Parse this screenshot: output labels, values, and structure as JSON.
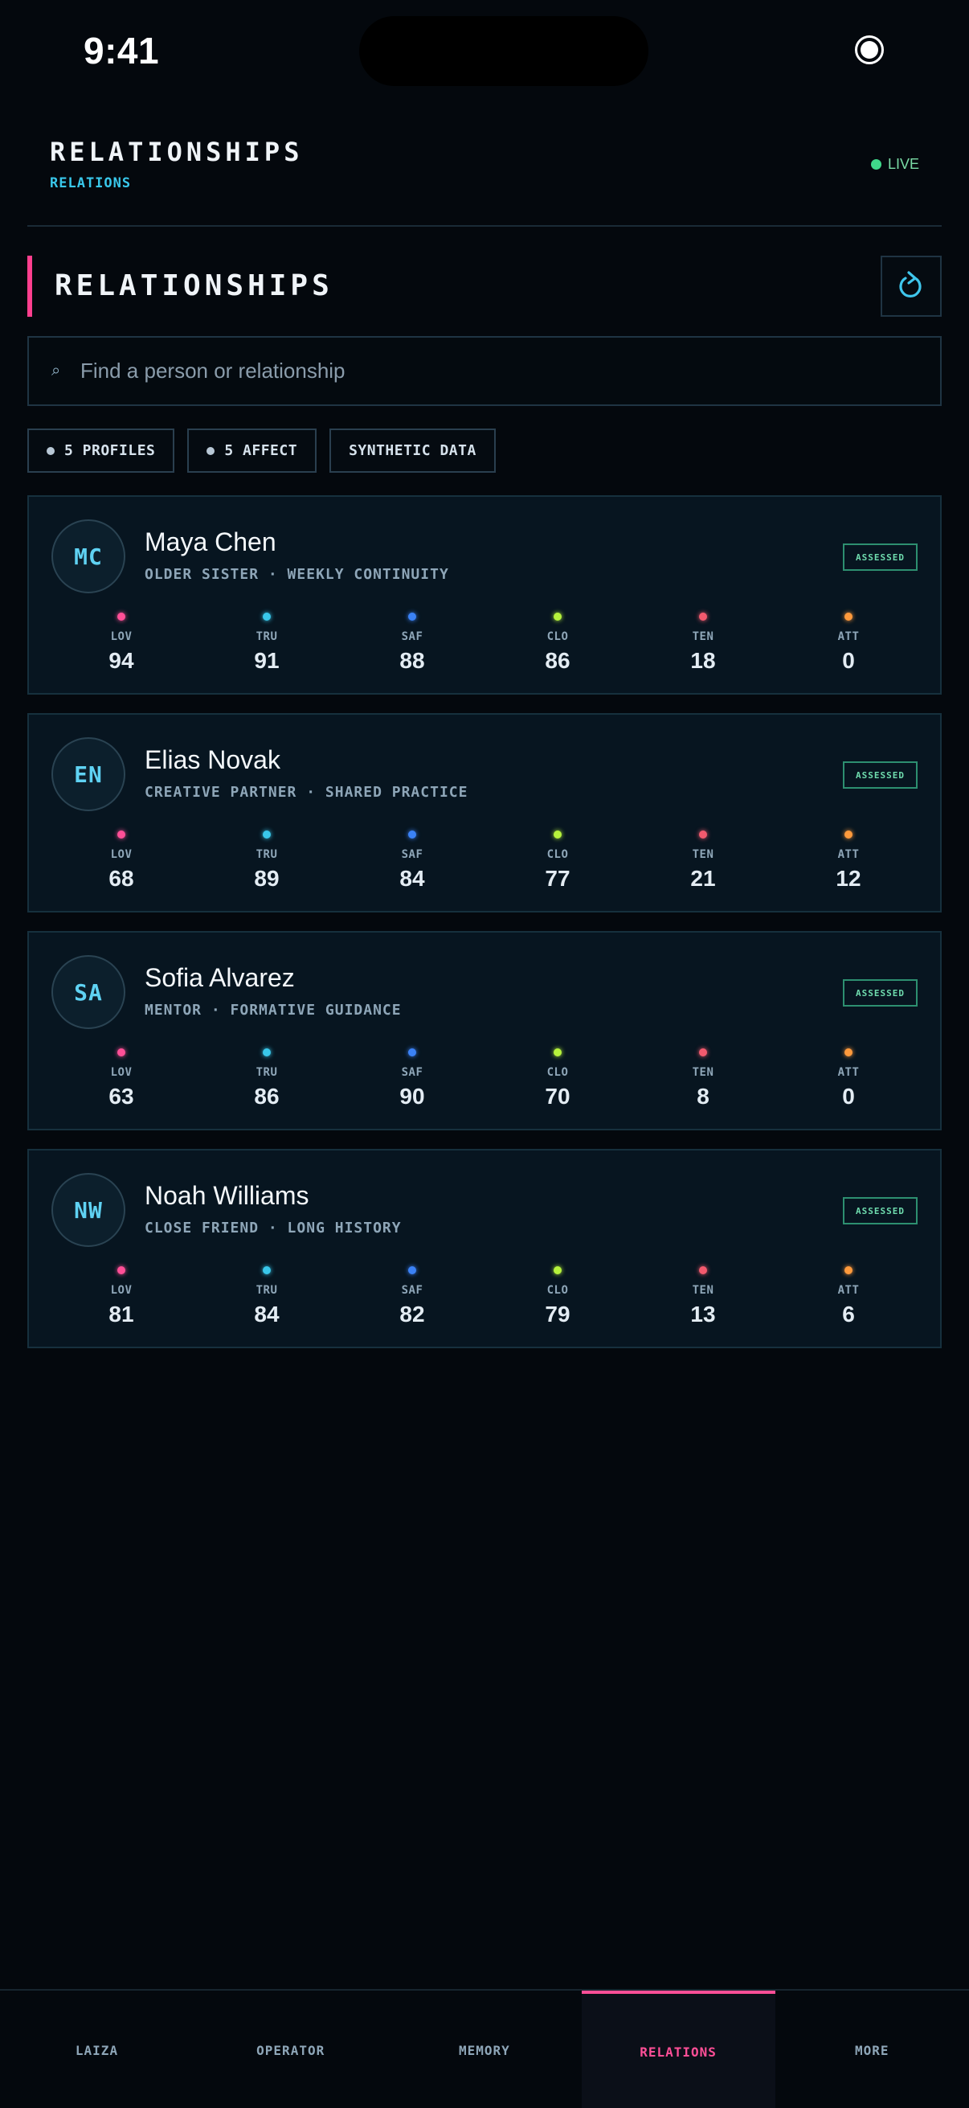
{
  "status_bar": {
    "time": "9:41"
  },
  "header": {
    "title": "RELATIONSHIPS",
    "subtitle": "RELATIONS",
    "live_label": "LIVE"
  },
  "section": {
    "title": "RELATIONSHIPS"
  },
  "search": {
    "placeholder": "Find a person or relationship",
    "value": ""
  },
  "chips": [
    {
      "label": "5 PROFILES",
      "has_dot": true
    },
    {
      "label": "5 AFFECT",
      "has_dot": true
    },
    {
      "label": "SYNTHETIC DATA",
      "has_dot": false
    }
  ],
  "metric_colors": {
    "LOV": "#ff4f97",
    "TRU": "#39c7ea",
    "SAF": "#3b82f6",
    "CLO": "#b6f23c",
    "TEN": "#f25a6e",
    "ATT": "#ff9a3c"
  },
  "people": [
    {
      "initials": "MC",
      "name": "Maya Chen",
      "role": "OLDER SISTER · WEEKLY CONTINUITY",
      "status": "ASSESSED",
      "metrics": [
        {
          "label": "LOV",
          "value": "94"
        },
        {
          "label": "TRU",
          "value": "91"
        },
        {
          "label": "SAF",
          "value": "88"
        },
        {
          "label": "CLO",
          "value": "86"
        },
        {
          "label": "TEN",
          "value": "18"
        },
        {
          "label": "ATT",
          "value": "0"
        }
      ]
    },
    {
      "initials": "EN",
      "name": "Elias Novak",
      "role": "CREATIVE PARTNER · SHARED PRACTICE",
      "status": "ASSESSED",
      "metrics": [
        {
          "label": "LOV",
          "value": "68"
        },
        {
          "label": "TRU",
          "value": "89"
        },
        {
          "label": "SAF",
          "value": "84"
        },
        {
          "label": "CLO",
          "value": "77"
        },
        {
          "label": "TEN",
          "value": "21"
        },
        {
          "label": "ATT",
          "value": "12"
        }
      ]
    },
    {
      "initials": "SA",
      "name": "Sofia Alvarez",
      "role": "MENTOR · FORMATIVE GUIDANCE",
      "status": "ASSESSED",
      "metrics": [
        {
          "label": "LOV",
          "value": "63"
        },
        {
          "label": "TRU",
          "value": "86"
        },
        {
          "label": "SAF",
          "value": "90"
        },
        {
          "label": "CLO",
          "value": "70"
        },
        {
          "label": "TEN",
          "value": "8"
        },
        {
          "label": "ATT",
          "value": "0"
        }
      ]
    },
    {
      "initials": "NW",
      "name": "Noah Williams",
      "role": "CLOSE FRIEND · LONG HISTORY",
      "status": "ASSESSED",
      "metrics": [
        {
          "label": "LOV",
          "value": "81"
        },
        {
          "label": "TRU",
          "value": "84"
        },
        {
          "label": "SAF",
          "value": "82"
        },
        {
          "label": "CLO",
          "value": "79"
        },
        {
          "label": "TEN",
          "value": "13"
        },
        {
          "label": "ATT",
          "value": "6"
        }
      ]
    }
  ],
  "tabs": [
    {
      "label": "LAIZA",
      "active": false
    },
    {
      "label": "OPERATOR",
      "active": false
    },
    {
      "label": "MEMORY",
      "active": false
    },
    {
      "label": "RELATIONS",
      "active": true
    },
    {
      "label": "MORE",
      "active": false
    }
  ]
}
